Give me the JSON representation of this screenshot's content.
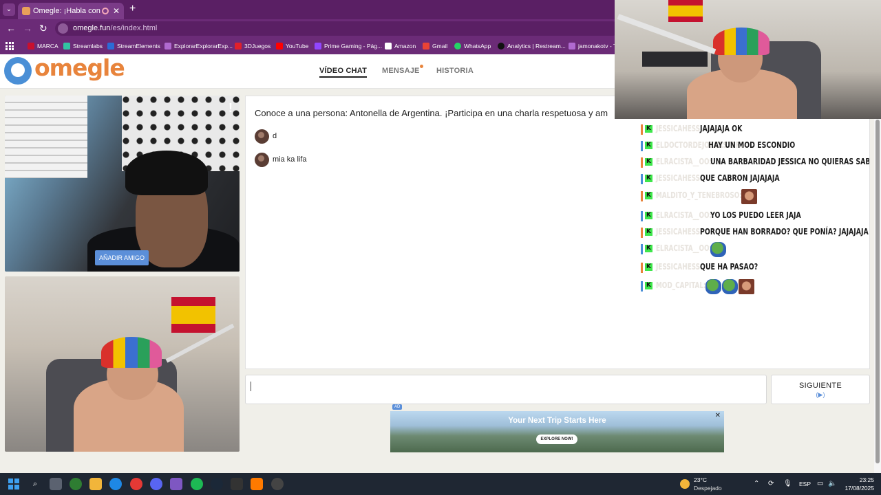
{
  "browser": {
    "tab_title": "Omegle: ¡Habla con Desconocidos!",
    "tab_close": "✕",
    "new_tab": "+",
    "url_domain": "omegle.fun",
    "url_path": "/es/index.html",
    "bookmarks": [
      "MARCA",
      "Streamlabs",
      "StreamElements",
      "ExplorarExplorarExp...",
      "3DJuegos",
      "YouTube",
      "Prime Gaming - Pág...",
      "Amazon",
      "Gmail",
      "WhatsApp",
      "Analytics | Restream...",
      "jamonakotv - T"
    ]
  },
  "site": {
    "logo": "omegle",
    "nav": [
      "VÍDEO CHAT",
      "MENSAJE",
      "HISTORIA"
    ],
    "report_flag": "!",
    "add_friend": "AÑADIR AMIGO",
    "intro": "Conoce a una persona: Antonella de Argentina. ¡Participa en una charla respetuosa y am",
    "messages": [
      "d",
      "mia ka lifa"
    ],
    "next_label": "SIGUIENTE",
    "next_icon": "(▶)",
    "ad_tag": "AD",
    "ad_title": "Your Next Trip Starts Here",
    "ad_button": "EXPLORE NOW!",
    "ad_close": "✕"
  },
  "stream_chat": [
    {
      "user": "JESSICAHESS:",
      "msg": "JAJAJAJA OK",
      "badge": "#e8843c"
    },
    {
      "user": "ELDOCTORDEJOKERSTERS:",
      "msg": "HAY UN MOD ESCONDIO",
      "badge": "#4a8fd6"
    },
    {
      "user": "ELRACISTA__OO:",
      "msg": "UNA BARBARIDAD JESSICA NO QUIERAS SABERLO...",
      "badge": "#e8843c"
    },
    {
      "user": "JESSICAHESS:",
      "msg": "QUE CABRON JAJAJAJA",
      "badge": "#4a8fd6"
    },
    {
      "user": "MALDITO_Y_TENEBROSO:",
      "msg": "",
      "badge": "#e8843c",
      "emotes": [
        "face"
      ]
    },
    {
      "user": "ELRACISTA__OO:",
      "msg": "YO LOS PUEDO LEER JAJA",
      "badge": "#4a8fd6"
    },
    {
      "user": "JESSICAHESS:",
      "msg": "PORQUE HAN BORRADO? QUE PONÍA? JAJAJAJA",
      "badge": "#e8843c"
    },
    {
      "user": "ELRACISTA__OO:",
      "msg": "",
      "badge": "#4a8fd6",
      "emotes": [
        "pepe"
      ]
    },
    {
      "user": "JESSICAHESS:",
      "msg": "QUE HA PASAO?",
      "badge": "#e8843c"
    },
    {
      "user": "MOD_CAPITAL:",
      "msg": "",
      "badge": "#4a8fd6",
      "emotes": [
        "pepe",
        "pepe",
        "face"
      ]
    }
  ],
  "taskbar": {
    "weather_temp": "23°C",
    "weather_desc": "Despejado",
    "lang": "ESP",
    "time": "23:25",
    "date": "17/08/2025"
  },
  "colors": {
    "browser_chrome": "#6b2b77",
    "omegle_orange": "#e8843c",
    "omegle_blue": "#4a8fd6",
    "kick_green": "#3ee64b"
  }
}
